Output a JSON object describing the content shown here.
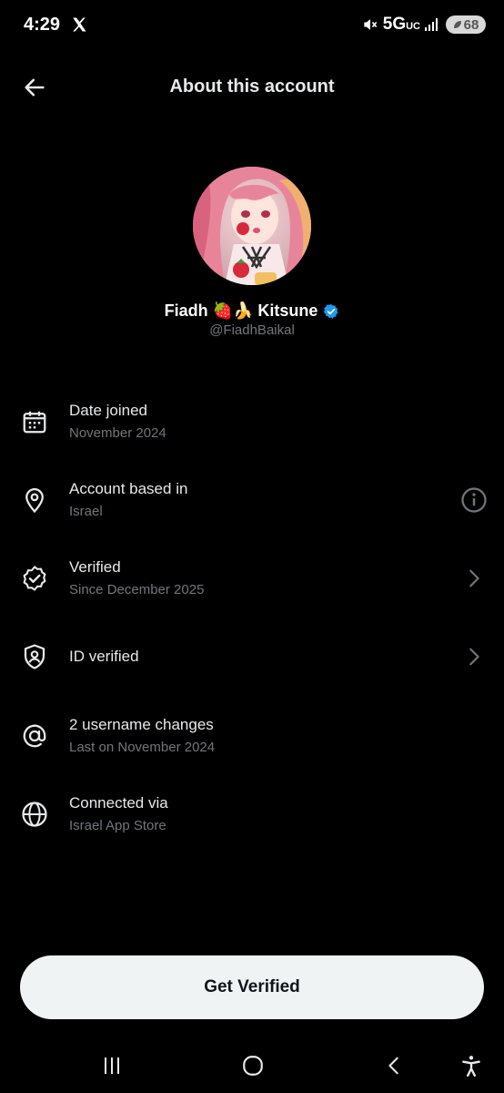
{
  "status_bar": {
    "time": "4:29",
    "network": "5G",
    "network_sub": "UC",
    "battery": "68"
  },
  "header": {
    "title": "About this account"
  },
  "profile": {
    "display_name": "Fiadh 🍓🍌 Kitsune",
    "handle": "@FiadhBaikal"
  },
  "rows": [
    {
      "title": "Date joined",
      "subtitle": "November 2024",
      "icon": "calendar-icon"
    },
    {
      "title": "Account based in",
      "subtitle": "Israel",
      "icon": "location-pin-icon",
      "right_icon": "info-icon"
    },
    {
      "title": "Verified",
      "subtitle": "Since December 2025",
      "icon": "verified-badge-icon",
      "right_icon": "chevron-right-icon"
    },
    {
      "title": "ID verified",
      "subtitle": "",
      "icon": "shield-user-icon",
      "right_icon": "chevron-right-icon"
    },
    {
      "title": "2 username changes",
      "subtitle": "Last on November 2024",
      "icon": "at-sign-icon"
    },
    {
      "title": "Connected via",
      "subtitle": "Israel App Store",
      "icon": "globe-icon"
    }
  ],
  "cta": {
    "label": "Get Verified"
  },
  "colors": {
    "background": "#000000",
    "primary_text": "#e7e9ea",
    "secondary_text": "#71767b",
    "verified_blue": "#1d9bf0",
    "button_bg": "#eff3f4"
  }
}
